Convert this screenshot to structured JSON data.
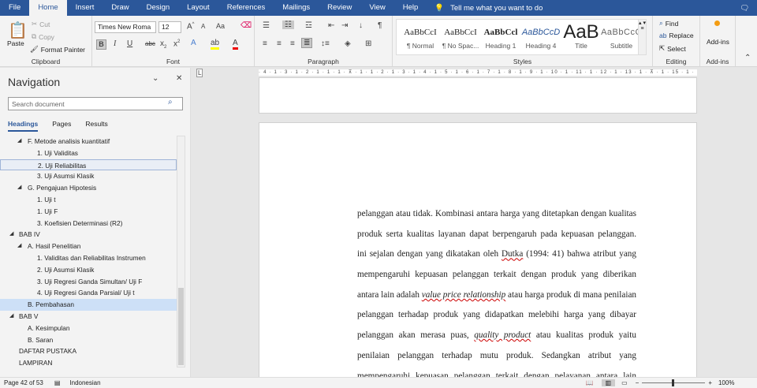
{
  "tabs": [
    "File",
    "Home",
    "Insert",
    "Draw",
    "Design",
    "Layout",
    "References",
    "Mailings",
    "Review",
    "View",
    "Help"
  ],
  "tell_me": "Tell me what you want to do",
  "clipboard": {
    "paste": "Paste",
    "cut": "Cut",
    "copy": "Copy",
    "format_painter": "Format Painter",
    "label": "Clipboard"
  },
  "font": {
    "name": "Times New Roma",
    "size": "12",
    "label": "Font",
    "aa": "Aa"
  },
  "paragraph": {
    "label": "Paragraph"
  },
  "styles": {
    "label": "Styles",
    "items": [
      {
        "preview": "AaBbCcI",
        "name": "¶ Normal"
      },
      {
        "preview": "AaBbCcI",
        "name": "¶ No Spac..."
      },
      {
        "preview": "AaBbCcl",
        "name": "Heading 1"
      },
      {
        "preview": "AaBbCcD",
        "name": "Heading 4"
      },
      {
        "preview": "AaB",
        "name": "Title"
      },
      {
        "preview": "AaBbCcC",
        "name": "Subtitle"
      }
    ]
  },
  "editing": {
    "find": "Find",
    "replace": "Replace",
    "select": "Select",
    "label": "Editing"
  },
  "addins": {
    "button": "Add-ins",
    "label": "Add-ins"
  },
  "nav": {
    "title": "Navigation",
    "search_placeholder": "Search document",
    "tabs": [
      "Headings",
      "Pages",
      "Results"
    ],
    "items": [
      {
        "t": "F. Metode analisis kuantitatif",
        "l": 2,
        "exp": true
      },
      {
        "t": "1. Uji Validitas",
        "l": 3
      },
      {
        "t": "2. Uji Reliabilitas",
        "l": 3,
        "hover": true
      },
      {
        "t": "3. Uji Asumsi Klasik",
        "l": 3
      },
      {
        "t": "G. Pengajuan Hipotesis",
        "l": 2,
        "exp": true
      },
      {
        "t": "1. Uji t",
        "l": 3
      },
      {
        "t": "1. Uji F",
        "l": 3
      },
      {
        "t": "3. Koefisien Determinasi (R2)",
        "l": 3
      },
      {
        "t": "BAB IV",
        "l": 1,
        "exp": true
      },
      {
        "t": "A. Hasil Penelitian",
        "l": 2,
        "exp": true
      },
      {
        "t": "1. Validitas dan Reliabilitas Instrumen",
        "l": 3
      },
      {
        "t": "2. Uji Asumsi Klasik",
        "l": 3
      },
      {
        "t": "3. Uji Regresi Ganda Simultan/ Uji F",
        "l": 3
      },
      {
        "t": "4. Uji Regresi Ganda Parsial/ Uji t",
        "l": 3
      },
      {
        "t": "B. Pembahasan",
        "l": 2,
        "sel": true
      },
      {
        "t": "BAB V",
        "l": 1,
        "exp": true
      },
      {
        "t": "A. Kesimpulan",
        "l": 2
      },
      {
        "t": "B. Saran",
        "l": 2
      },
      {
        "t": "DAFTAR PUSTAKA",
        "l": 1
      },
      {
        "t": "LAMPIRAN",
        "l": 1
      }
    ]
  },
  "ruler": "· 4 · 1 · 3 · 1 · 2 · 1 · 1 · 1 · ⊼ · 1 · 1 · 2 · 1 · 3 · 1 · 4 · 1 · 5 · 1 · 6 · 1 · 7 · 1 · 8 · 1 · 9 · 1 · 10 · 1 · 11 · 1 · 12 · 1 · 13 · 1 · ⊼ · 1 · 15 · 1 · 16 · 1",
  "document": {
    "lines": [
      [
        {
          "t": "pelanggan atau tidak. Kombinasi antara harga yang ditetapkan dengan kualitas"
        }
      ],
      [
        {
          "t": "produk serta kualitas layanan dapat berpengaruh pada kepuasan pelanggan. Hal"
        }
      ],
      [
        {
          "t": "ini sejalan dengan yang dikatakan oleh "
        },
        {
          "t": "Dutka",
          "u": true
        },
        {
          "t": " (1994: 41) bahwa atribut yang"
        }
      ],
      [
        {
          "t": "mempengaruhi kepuasan pelanggan terkait dengan produk yang diberikan"
        }
      ],
      [
        {
          "t": "antara lain adalah "
        },
        {
          "t": "value price relationship",
          "i": true
        },
        {
          "t": " atau harga produk di mana penilaian"
        }
      ],
      [
        {
          "t": "pelanggan terhadap produk yang didapatkan melebihi harga yang dibayar maka"
        }
      ],
      [
        {
          "t": "pelanggan akan merasa puas, "
        },
        {
          "t": "quality product",
          "i": true
        },
        {
          "t": " atau kualitas produk yaitu"
        }
      ],
      [
        {
          "t": "penilaian pelanggan terhadap mutu produk. Sedangkan atribut yang"
        }
      ],
      [
        {
          "t": "mempengaruhi kepuasan pelanggan terkait dengan pelayanan antara lain"
        }
      ]
    ]
  },
  "status": {
    "page": "Page 42 of 53",
    "language": "Indonesian",
    "zoom": "100%",
    "zoom_minus": "−",
    "zoom_plus": "+"
  },
  "colors": {
    "brand": "#2b579a",
    "selection": "#cde0f7"
  }
}
